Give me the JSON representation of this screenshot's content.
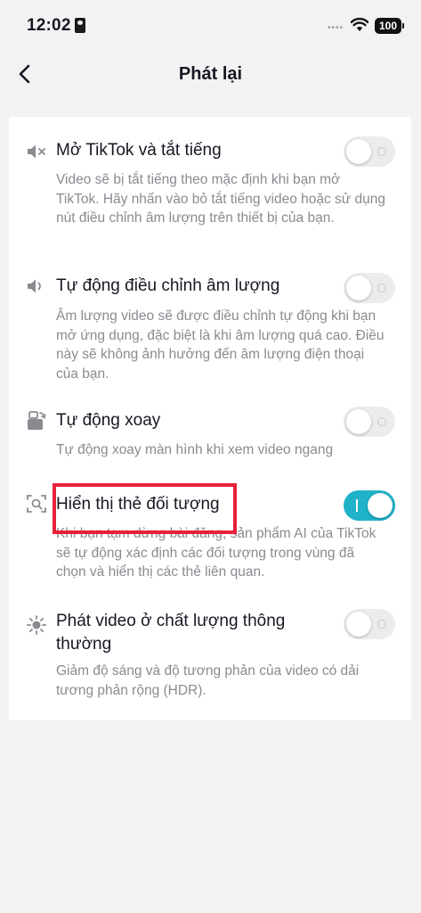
{
  "status_bar": {
    "time": "12:02",
    "dots": "••••",
    "battery": "100"
  },
  "header": {
    "title": "Phát lại"
  },
  "settings": [
    {
      "icon": "speaker-muted-icon",
      "title": "Mở TikTok và tắt tiếng",
      "description": "Video sẽ bị tắt tiếng theo mặc định khi bạn mở TikTok. Hãy nhấn vào bỏ tắt tiếng video hoặc sử dụng nút điều chỉnh âm lượng trên thiết bị của bạn.",
      "enabled": false
    },
    {
      "icon": "speaker-volume-icon",
      "title": "Tự động điều chỉnh âm lượng",
      "description": "Âm lượng video sẽ được điều chỉnh tự động khi bạn mở ứng dụng, đặc biệt là khi âm lượng quá cao. Điều này sẽ không ảnh hưởng đến âm lượng điện thoại của bạn.",
      "enabled": false
    },
    {
      "icon": "rotate-screen-icon",
      "title": "Tự động xoay",
      "description": "Tự động xoay màn hình khi xem video ngang",
      "enabled": false
    },
    {
      "icon": "object-scan-icon",
      "title": "Hiển thị thẻ đối tượng",
      "description": "Khi bạn tạm dừng bài đăng, sản phẩm AI của TikTok sẽ tự động xác định các đối tượng trong vùng đã chọn và hiển thị các thẻ liên quan.",
      "enabled": true
    },
    {
      "icon": "brightness-icon",
      "title": "Phát video ở chất lượng thông thường",
      "description": "Giảm độ sáng và độ tương phản của video có dải tương phản rộng (HDR).",
      "enabled": false
    }
  ],
  "colors": {
    "toggle_on": "#20b2c8",
    "toggle_off": "#ececec",
    "highlight": "#e8203b"
  }
}
